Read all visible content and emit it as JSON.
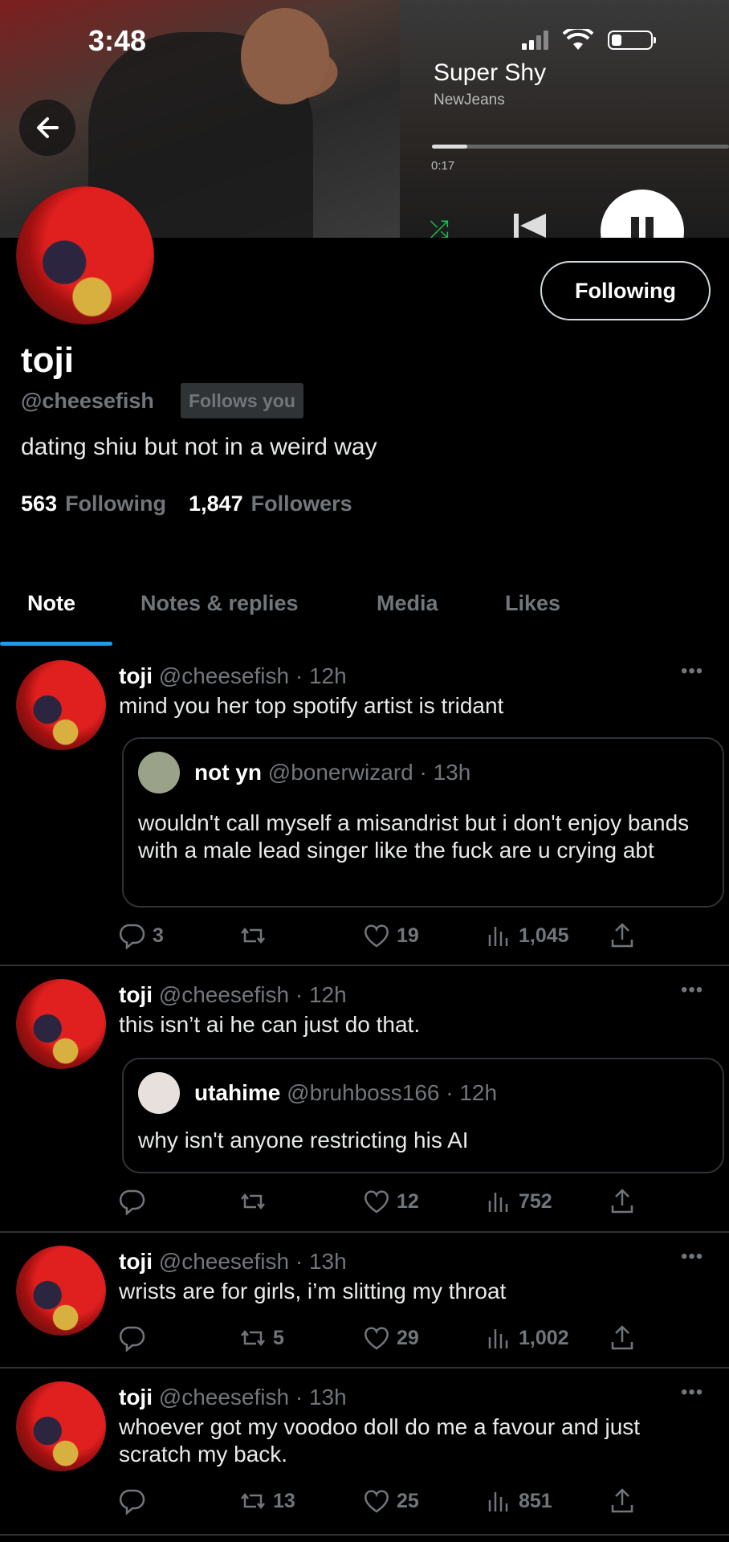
{
  "status_bar": {
    "time": "3:48"
  },
  "now_playing": {
    "title": "Super Shy",
    "artist": "NewJeans",
    "elapsed": "0:17",
    "progress": 0.12
  },
  "profile": {
    "name": "toji",
    "handle": "@cheesefish",
    "follows_you": "Follows you",
    "bio": "dating shiu but not in a weird way",
    "following_count": "563",
    "following_label": "Following",
    "followers_count": "1,847",
    "followers_label": "Followers",
    "follow_button": "Following"
  },
  "tabs": [
    {
      "label": "Note",
      "active": true
    },
    {
      "label": "Notes & replies",
      "active": false
    },
    {
      "label": "Media",
      "active": false
    },
    {
      "label": "Likes",
      "active": false
    }
  ],
  "tweets": [
    {
      "name": "toji",
      "meta": "@cheesefish · 12h",
      "text": "mind you her top spotify artist is tridant",
      "quote": {
        "name": "not yn",
        "meta": "@bonerwizard · 13h",
        "text": "wouldn't call myself a misandrist but i don't enjoy bands with a male lead singer like the fuck are u crying abt"
      },
      "replies": "3",
      "retweets": "",
      "likes": "19",
      "views": "1,045"
    },
    {
      "name": "toji",
      "meta": "@cheesefish · 12h",
      "text": "this isn’t ai he can just do that.",
      "quote": {
        "name": "utahime",
        "meta": "@bruhboss166 · 12h",
        "text": "why isn't anyone restricting his AI"
      },
      "replies": "",
      "retweets": "",
      "likes": "12",
      "views": "752"
    },
    {
      "name": "toji",
      "meta": "@cheesefish · 13h",
      "text": "wrists are for girls, i’m slitting my throat",
      "replies": "",
      "retweets": "5",
      "likes": "29",
      "views": "1,002"
    },
    {
      "name": "toji",
      "meta": "@cheesefish · 13h",
      "text": "whoever got my voodoo doll do me a favour and just scratch my back.",
      "replies": "",
      "retweets": "13",
      "likes": "25",
      "views": "851"
    }
  ]
}
